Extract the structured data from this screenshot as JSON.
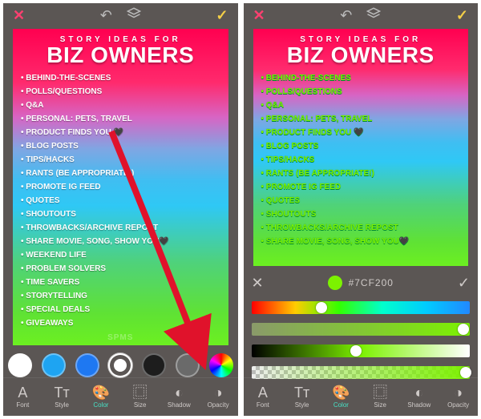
{
  "subtitle": "STORY IDEAS FOR",
  "title": "BIZ OWNERS",
  "bullets": [
    "BEHIND-THE-SCENES",
    "POLLS/QUESTIONS",
    "Q&A",
    "PERSONAL: PETS, TRAVEL",
    "PRODUCT FINDS YOU 🖤",
    "BLOG POSTS",
    "TIPS/HACKS",
    "RANTS (BE APPROPRIATE!)",
    "PROMOTE IG FEED",
    "QUOTES",
    "SHOUTOUTS",
    "THROWBACKS/ARCHIVE REPOST",
    "SHARE MOVIE, SONG, SHOW YOU🖤",
    "WEEKEND LIFE",
    "PROBLEM SOLVERS",
    "TIME SAVERS",
    "STORYTELLING",
    "SPECIAL DEALS",
    "GIVEAWAYS"
  ],
  "watermark": "SPMS",
  "swatches": [
    {
      "color": "#ffffff",
      "ring": false
    },
    {
      "color": "#1ea4f2",
      "ring": false
    },
    {
      "color": "#1e78f2",
      "ring": false
    },
    {
      "color": "#ffffff",
      "ring": true
    },
    {
      "color": "#1d1d1d",
      "ring": false
    },
    {
      "color": "#6a6a6a",
      "ring": false
    }
  ],
  "tabs": [
    {
      "id": "font",
      "label": "Font",
      "icon": "A"
    },
    {
      "id": "style",
      "label": "Style",
      "icon": "Tᴛ"
    },
    {
      "id": "color",
      "label": "Color",
      "icon": "🎨"
    },
    {
      "id": "size",
      "label": "Size",
      "icon": "⿴"
    },
    {
      "id": "shadow",
      "label": "Shadow",
      "icon": "◐"
    },
    {
      "id": "opacity",
      "label": "Opacity",
      "icon": "◑"
    }
  ],
  "active_tab": "color",
  "picker": {
    "hex": "#7CF200",
    "hue_pos": 0.32,
    "sat_pos": 0.97,
    "lig_pos": 0.48,
    "alpha_pos": 0.98
  }
}
